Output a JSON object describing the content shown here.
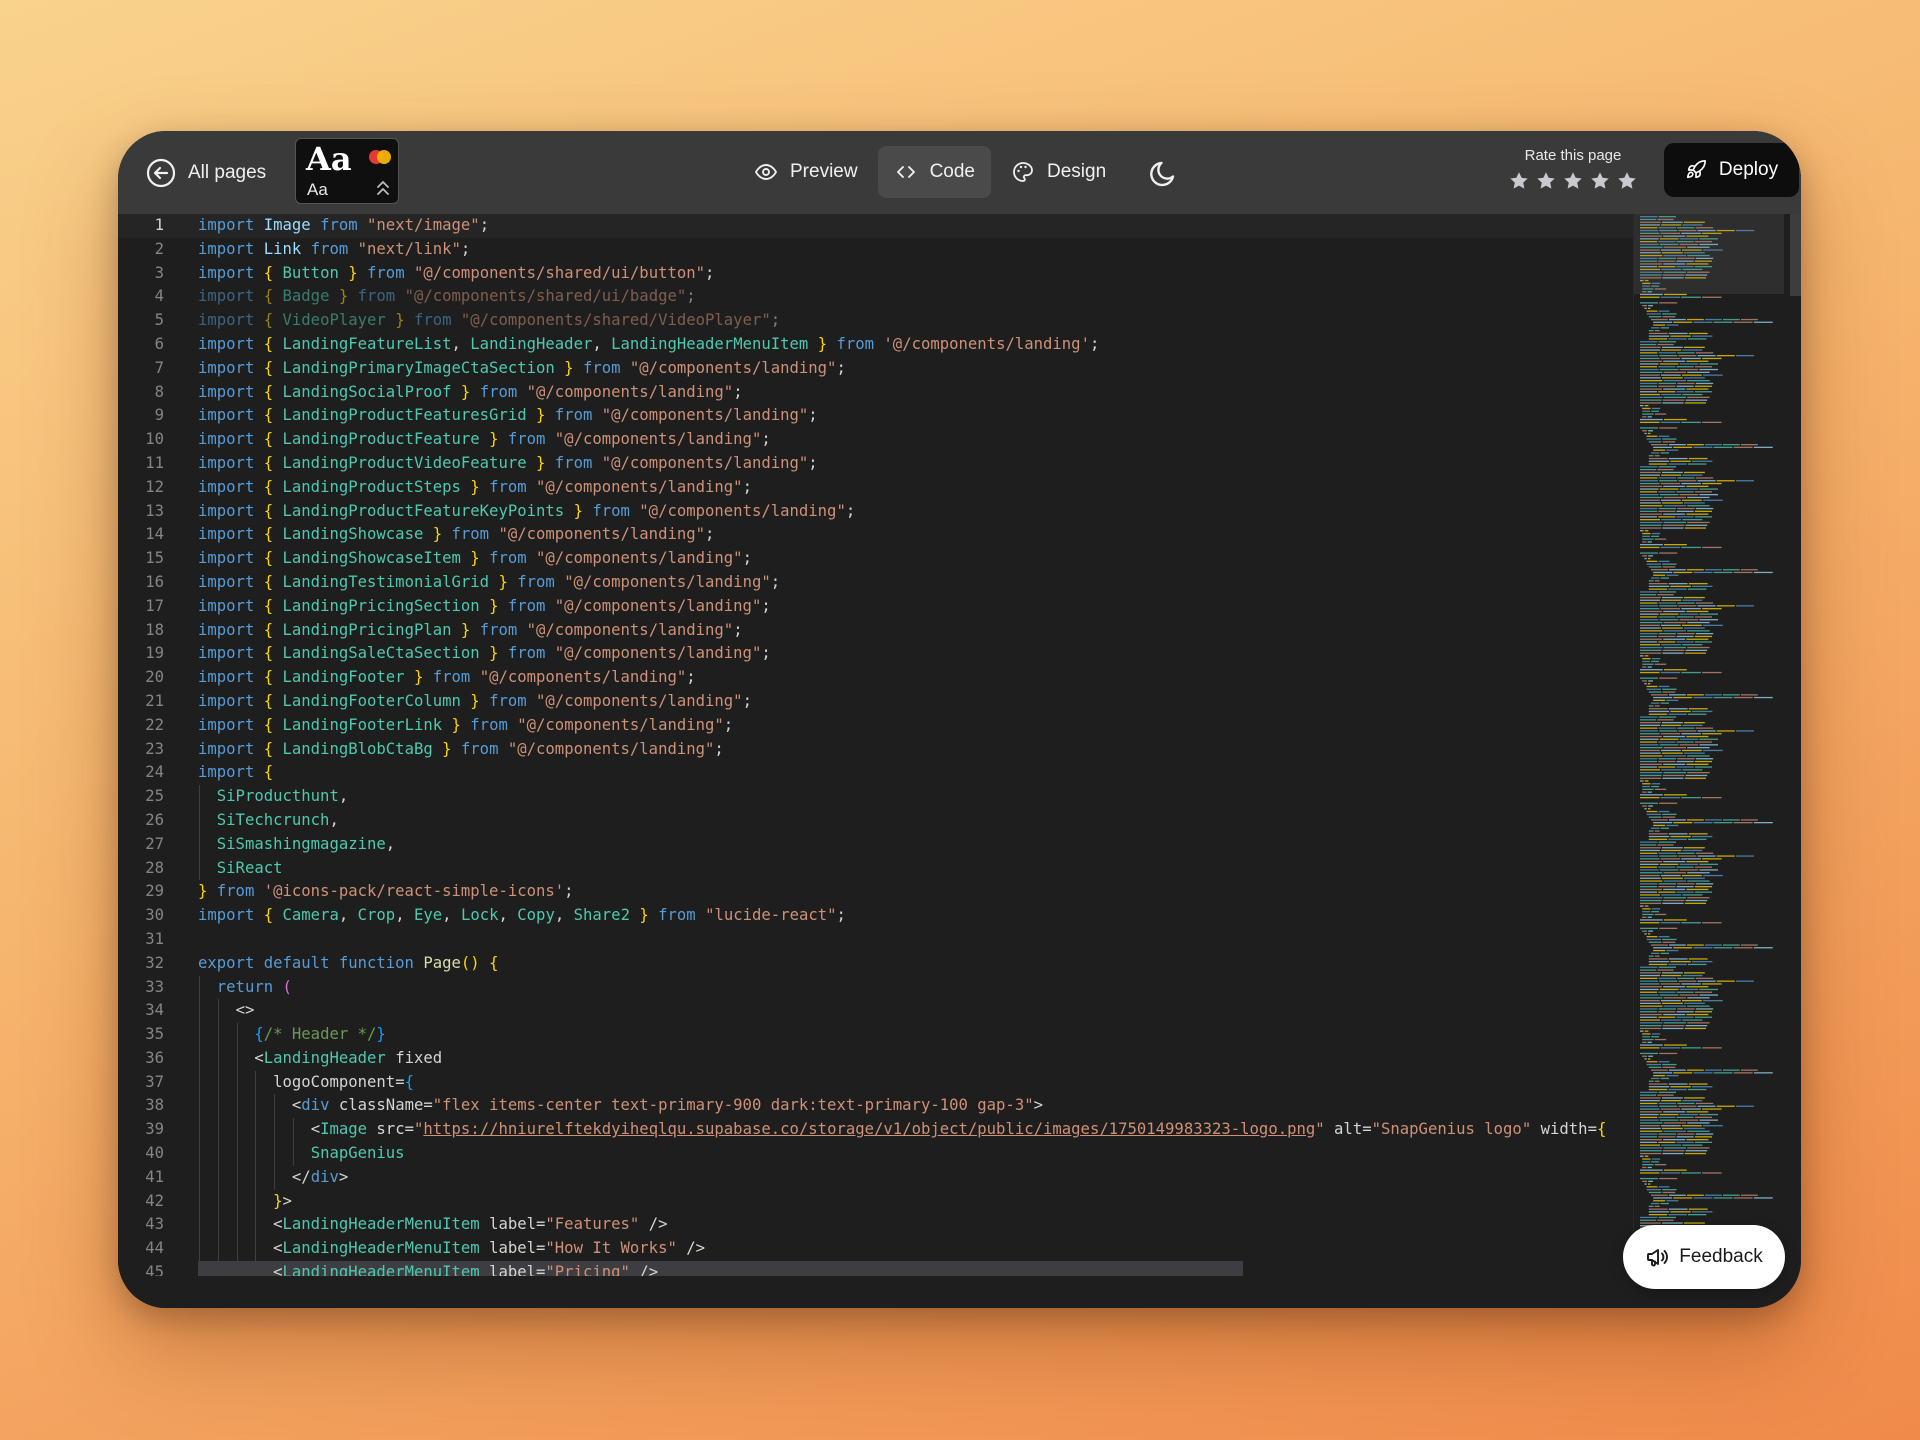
{
  "header": {
    "back_label": "All pages",
    "font_picker": {
      "display": "Aa",
      "body": "Aa"
    },
    "tabs": [
      {
        "label": "Preview",
        "icon": "eye-icon"
      },
      {
        "label": "Code",
        "icon": "code-icon",
        "active": true
      },
      {
        "label": "Design",
        "icon": "palette-icon"
      }
    ],
    "theme_icon": "moon-icon",
    "rating": {
      "label": "Rate this page",
      "stars": 5,
      "value": 0
    },
    "deploy_label": "Deploy"
  },
  "feedback_label": "Feedback",
  "colors": {
    "topbar": "#3a3a3a",
    "editor_bg": "#1e1e1e",
    "keyword": "#569cd6",
    "identifier": "#9cdcfe",
    "string": "#ce9178",
    "type": "#4ec9b0",
    "bracket": "#ffd700",
    "comment": "#6a9955"
  },
  "editor": {
    "current_line": 1,
    "lines": [
      "import Image from \"next/image\";",
      "import Link from \"next/link\";",
      "import { Button } from \"@/components/shared/ui/button\";",
      "import { Badge } from \"@/components/shared/ui/badge\";",
      "import { VideoPlayer } from \"@/components/shared/VideoPlayer\";",
      "import { LandingFeatureList, LandingHeader, LandingHeaderMenuItem } from '@/components/landing';",
      "import { LandingPrimaryImageCtaSection } from \"@/components/landing\";",
      "import { LandingSocialProof } from \"@/components/landing\";",
      "import { LandingProductFeaturesGrid } from \"@/components/landing\";",
      "import { LandingProductFeature } from \"@/components/landing\";",
      "import { LandingProductVideoFeature } from \"@/components/landing\";",
      "import { LandingProductSteps } from \"@/components/landing\";",
      "import { LandingProductFeatureKeyPoints } from \"@/components/landing\";",
      "import { LandingShowcase } from \"@/components/landing\";",
      "import { LandingShowcaseItem } from \"@/components/landing\";",
      "import { LandingTestimonialGrid } from \"@/components/landing\";",
      "import { LandingPricingSection } from \"@/components/landing\";",
      "import { LandingPricingPlan } from \"@/components/landing\";",
      "import { LandingSaleCtaSection } from \"@/components/landing\";",
      "import { LandingFooter } from \"@/components/landing\";",
      "import { LandingFooterColumn } from \"@/components/landing\";",
      "import { LandingFooterLink } from \"@/components/landing\";",
      "import { LandingBlobCtaBg } from \"@/components/landing\";",
      "import {",
      "  SiProducthunt,",
      "  SiTechcrunch,",
      "  SiSmashingmagazine,",
      "  SiReact",
      "} from '@icons-pack/react-simple-icons';",
      "import { Camera, Crop, Eye, Lock, Copy, Share2 } from \"lucide-react\";",
      "",
      "export default function Page() {",
      "  return (",
      "    <>",
      "      {/* Header */}",
      "      <LandingHeader fixed",
      "        logoComponent={",
      "          <div className=\"flex items-center text-primary-900 dark:text-primary-100 gap-3\">",
      "            <Image src=\"https://hniurelftekdyiheqlqu.supabase.co/storage/v1/object/public/images/1750149983323-logo.png\" alt=\"SnapGenius logo\" width={",
      "            SnapGenius",
      "          </div>",
      "        }>",
      "        <LandingHeaderMenuItem label=\"Features\" />",
      "        <LandingHeaderMenuItem label=\"How It Works\" />",
      "        <LandingHeaderMenuItem label=\"Pricing\" />"
    ]
  }
}
